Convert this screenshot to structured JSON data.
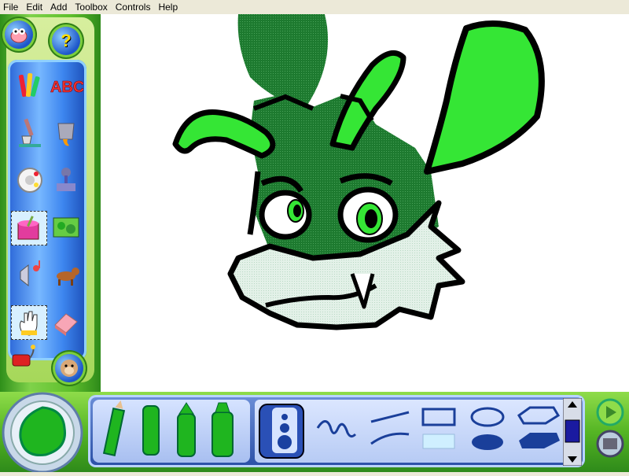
{
  "menu": {
    "items": [
      "File",
      "Edit",
      "Add",
      "Toolbox",
      "Controls",
      "Help"
    ]
  },
  "left_toolbar": {
    "help_label": "?",
    "tools": [
      {
        "name": "crayon-tool-icon"
      },
      {
        "name": "text-tool-icon",
        "label": "ABC"
      },
      {
        "name": "brush-tool-icon"
      },
      {
        "name": "paint-bucket-tool-icon"
      },
      {
        "name": "stickers-tool-icon"
      },
      {
        "name": "stamper-tool-icon"
      },
      {
        "name": "paint-can-tool-icon"
      },
      {
        "name": "background-image-tool-icon"
      },
      {
        "name": "sound-tool-icon"
      },
      {
        "name": "animation-dog-icon"
      },
      {
        "name": "hand-tool-icon"
      },
      {
        "name": "eraser-tool-icon"
      }
    ],
    "bottom_tools": [
      "dynamite-eraser-icon",
      "monkey-helper-icon"
    ]
  },
  "bottom_bar": {
    "markers": [
      "pencil-icon",
      "crayon-marker-icon",
      "thick-crayon-icon",
      "highlighter-marker-icon"
    ],
    "shape_tools": [
      "freehand-line-icon",
      "straight-line-icon",
      "rectangle-outline-icon",
      "ellipse-outline-icon",
      "polygon-outline-icon",
      "curved-line-icon",
      "rectangle-filled-icon",
      "ellipse-filled-icon",
      "polygon-filled-icon"
    ],
    "current_color": "#1fb51f"
  },
  "colors": {
    "dark_green": "#1f7a2e",
    "light_green": "#35e635",
    "pale": "#dff0e6",
    "outline": "#000000"
  }
}
